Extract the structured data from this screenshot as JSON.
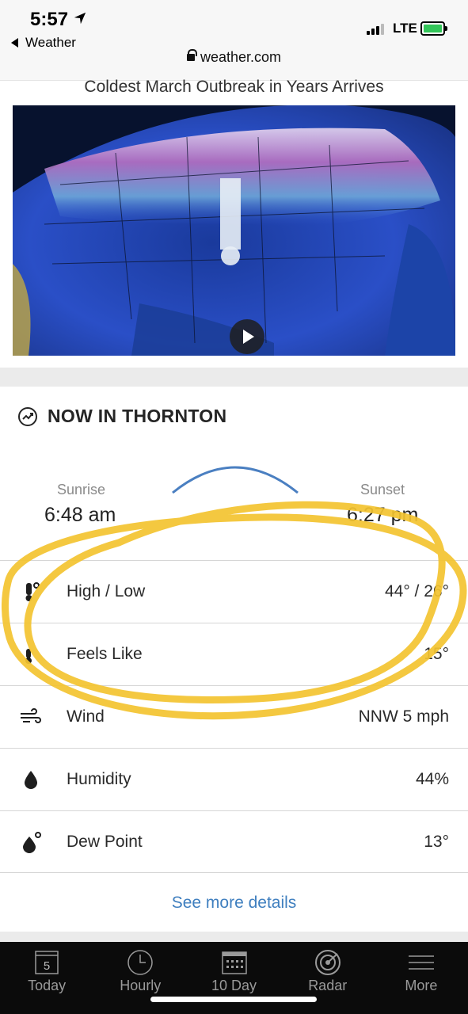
{
  "status_bar": {
    "time": "5:57",
    "back_label": "Weather",
    "carrier": "LTE",
    "url": "weather.com"
  },
  "article": {
    "headline": "Coldest March Outbreak in Years Arrives"
  },
  "now": {
    "title": "NOW IN THORNTON",
    "sunrise_label": "Sunrise",
    "sunrise_value": "6:48 am",
    "sunset_label": "Sunset",
    "sunset_value": "6:27 pm",
    "details": [
      {
        "icon": "thermometer-icon",
        "label": "High / Low",
        "value": "44° / 26°"
      },
      {
        "icon": "feels-like-icon",
        "label": "Feels Like",
        "value": "15°"
      },
      {
        "icon": "wind-icon",
        "label": "Wind",
        "value": "NNW 5 mph"
      },
      {
        "icon": "humidity-drop-icon",
        "label": "Humidity",
        "value": "44%"
      },
      {
        "icon": "dew-point-icon",
        "label": "Dew Point",
        "value": "13°"
      }
    ],
    "see_more": "See more details"
  },
  "tabbar": {
    "tabs": [
      {
        "label": "Today",
        "icon": "calendar-day-icon",
        "badge": "5"
      },
      {
        "label": "Hourly",
        "icon": "clock-icon"
      },
      {
        "label": "10 Day",
        "icon": "calendar-grid-icon"
      },
      {
        "label": "Radar",
        "icon": "radar-icon"
      },
      {
        "label": "More",
        "icon": "menu-icon"
      }
    ]
  },
  "colors": {
    "link": "#3f7fbf",
    "annotation": "#f4c430",
    "sun_arc": "#4a7fc1",
    "tab_bg": "#0b0b0b"
  }
}
